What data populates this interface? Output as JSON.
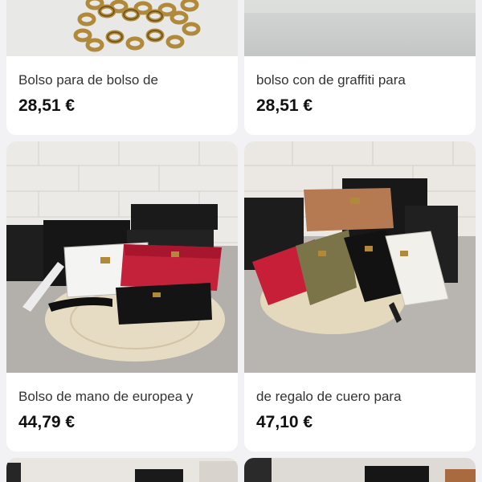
{
  "products": [
    {
      "title": "Bolso para de bolso de",
      "price": "28,51 €",
      "image": "gold-chain-strap"
    },
    {
      "title": "bolso con de graffiti para",
      "price": "28,51 €",
      "image": "gray-fabric"
    },
    {
      "title": "Bolso de mano de europea y",
      "price": "44,79 €",
      "image": "clutch-set-on-mat"
    },
    {
      "title": "de regalo de cuero para",
      "price": "47,10 €",
      "image": "wallet-set-with-boxes"
    },
    {
      "image": "bag-photo"
    },
    {
      "image": "bag-photo"
    }
  ]
}
